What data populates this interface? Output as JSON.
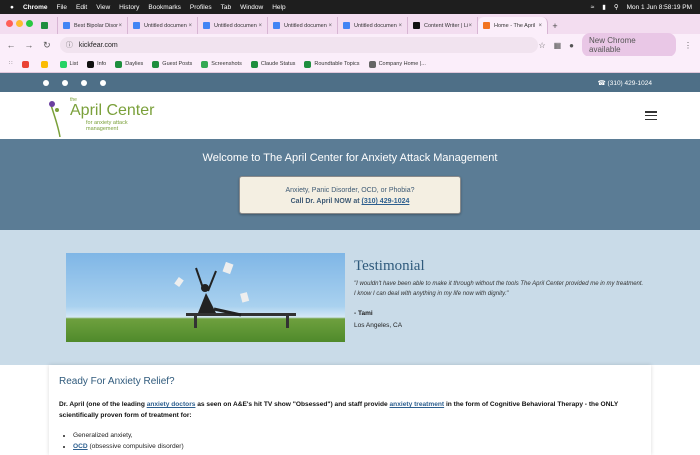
{
  "menubar": {
    "app": "Chrome",
    "menus": [
      "File",
      "Edit",
      "View",
      "History",
      "Bookmarks",
      "Profiles",
      "Tab",
      "Window",
      "Help"
    ],
    "clock": "Mon 1 Jun  8:58:19 PM"
  },
  "tabs": [
    {
      "title": "Best Bipolar Disor"
    },
    {
      "title": "Untitled documen"
    },
    {
      "title": "Untitled documen"
    },
    {
      "title": "Untitled documen"
    },
    {
      "title": "Untitled documen"
    },
    {
      "title": "Content Writer | Li"
    },
    {
      "title": "Home - The April"
    }
  ],
  "omnibox": {
    "url": "kickfear.com",
    "new_chrome": "New Chrome available"
  },
  "bookmarks": [
    "List",
    "Info",
    "Daylies",
    "Guest Posts",
    "Screenshots",
    "Claude Status",
    "Roundtable Topics",
    "Company Home |..."
  ],
  "site": {
    "phone": "(310) 429-1024",
    "logo": {
      "the": "the",
      "name": "April Center",
      "sub1": "for anxiety attack",
      "sub2": "management"
    },
    "hero_title": "Welcome to The April Center for Anxiety Attack Management",
    "cta_line1": "Anxiety, Panic Disorder, OCD, or Phobia?",
    "cta_line2_prefix": "Call Dr. April NOW at ",
    "cta_phone": "(310) 429-1024",
    "testimonial": {
      "heading": "Testimonial",
      "quote": "\"I wouldn't have been able to make it through without the tools The April Center provided me in my treatment. I know I can deal with anything in my life now with dignity.\"",
      "author": "- Tami",
      "location": "Los Angeles, CA"
    },
    "relief": {
      "heading": "Ready For Anxiety Relief?",
      "p_a": "Dr. April (one of the leading ",
      "link1": "anxiety doctors",
      "p_b": " as seen on A&E's hit TV show \"Obsessed\") and staff provide ",
      "link2": "anxiety treatment",
      "p_c": " in the form of Cognitive Behavioral Therapy - the ONLY scientifically proven form of treatment for:",
      "list1": "Generalized anxiety,",
      "list2_link": "OCD",
      "list2_rest": " (obsessive compulsive disorder)"
    }
  }
}
